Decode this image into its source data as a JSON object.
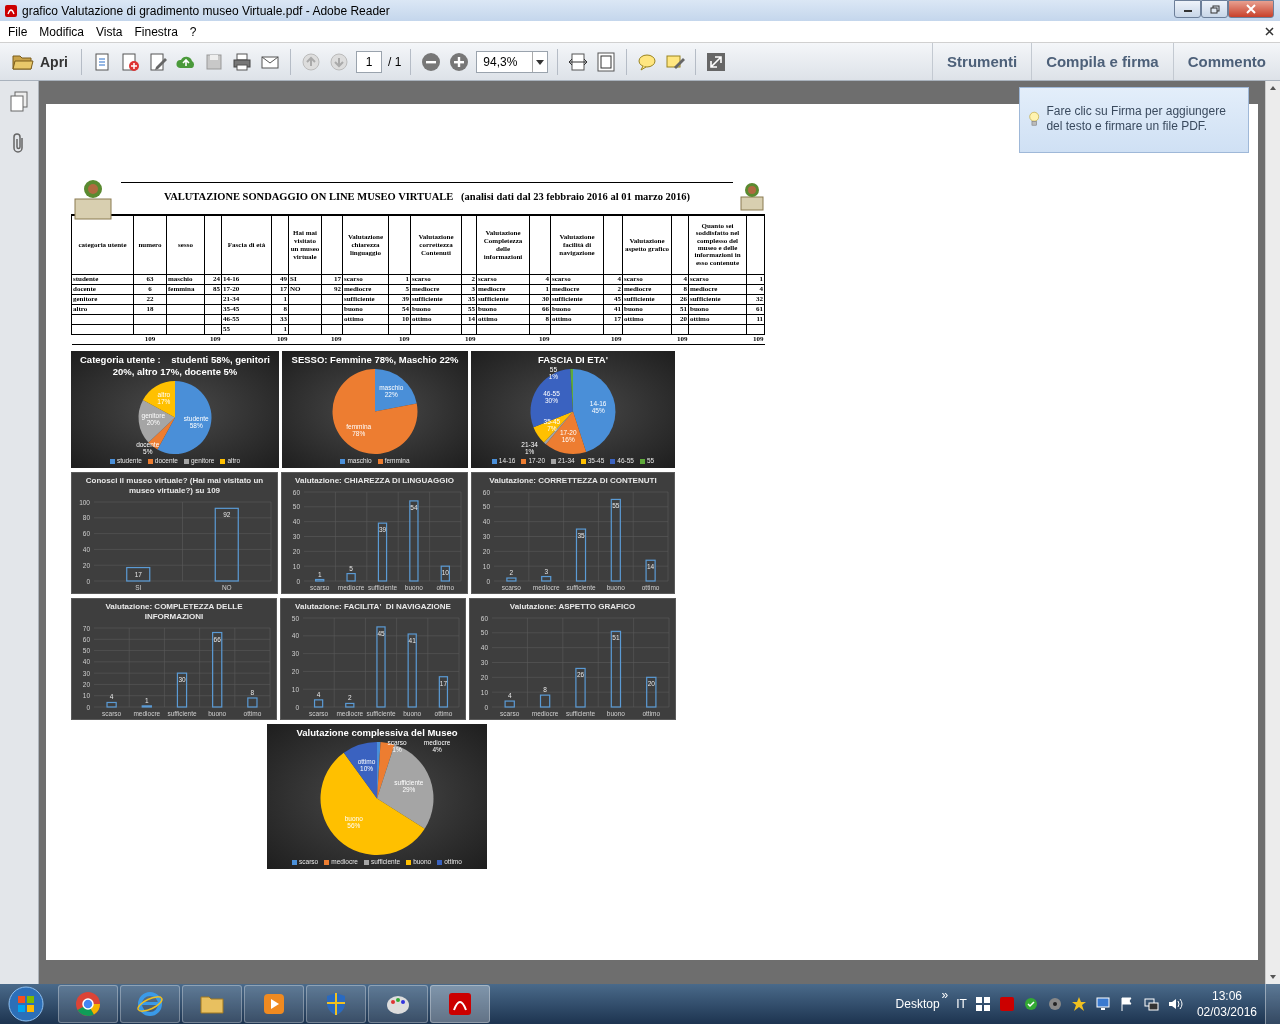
{
  "window": {
    "title": "grafico Valutazione di gradimento museo Virtuale.pdf - Adobe Reader"
  },
  "menu": [
    "File",
    "Modifica",
    "Vista",
    "Finestra",
    "?"
  ],
  "toolbar": {
    "open_label": "Apri",
    "page": "1",
    "page_total": "/ 1",
    "zoom": "94,3%",
    "panels": [
      "Strumenti",
      "Compila e firma",
      "Commento"
    ]
  },
  "tooltip": {
    "text": "Fare clic su Firma per aggiungere del testo e firmare un file PDF."
  },
  "document": {
    "title": "VALUTAZIONE SONDAGGIO ON LINE MUSEO VIRTUALE   (analisi dati dal 23 febbraio 2016 al 01 marzo 2016)",
    "table": {
      "groups": [
        {
          "header": "categoria utente",
          "value_header": "numero",
          "entries": [
            {
              "label": "studente",
              "value": "63"
            },
            {
              "label": "docente",
              "value": "6"
            },
            {
              "label": "genitore",
              "value": "22"
            },
            {
              "label": "altro",
              "value": "18"
            }
          ],
          "total": "109"
        },
        {
          "header": "sesso",
          "entries": [
            {
              "label": "maschio",
              "value": "24"
            },
            {
              "label": "femmina",
              "value": "85"
            }
          ],
          "total": "109"
        },
        {
          "header": "Fascia di età",
          "entries": [
            {
              "label": "14-16",
              "value": "49"
            },
            {
              "label": "17-20",
              "value": "17"
            },
            {
              "label": "21-34",
              "value": "1"
            },
            {
              "label": "35-45",
              "value": "8"
            },
            {
              "label": "46-55",
              "value": "33"
            },
            {
              "label": "55",
              "value": "1"
            }
          ],
          "total": "109"
        },
        {
          "header": "Hai mai visitato un museo virtuale",
          "entries": [
            {
              "label": "SI",
              "value": "17"
            },
            {
              "label": "NO",
              "value": "92"
            }
          ],
          "total": "109"
        },
        {
          "header": "Valutazione chiarezza linguaggio",
          "entries": [
            {
              "label": "scarso",
              "value": "1"
            },
            {
              "label": "mediocre",
              "value": "5"
            },
            {
              "label": "sufficiente",
              "value": "39"
            },
            {
              "label": "buono",
              "value": "54"
            },
            {
              "label": "ottimo",
              "value": "10"
            }
          ],
          "total": "109"
        },
        {
          "header": "Valutazione correttezza Contenuti",
          "entries": [
            {
              "label": "scarso",
              "value": "2"
            },
            {
              "label": "mediocre",
              "value": "3"
            },
            {
              "label": "sufficiente",
              "value": "35"
            },
            {
              "label": "buono",
              "value": "55"
            },
            {
              "label": "ottimo",
              "value": "14"
            }
          ],
          "total": "109"
        },
        {
          "header": "Valutazione Completezza delle informazioni",
          "entries": [
            {
              "label": "scarso",
              "value": "4"
            },
            {
              "label": "mediocre",
              "value": "1"
            },
            {
              "label": "sufficiente",
              "value": "30"
            },
            {
              "label": "buono",
              "value": "66"
            },
            {
              "label": "ottimo",
              "value": "8"
            }
          ],
          "total": "109"
        },
        {
          "header": "Valutazione facilità di navigazione",
          "entries": [
            {
              "label": "scarso",
              "value": "4"
            },
            {
              "label": "mediocre",
              "value": "2"
            },
            {
              "label": "sufficiente",
              "value": "45"
            },
            {
              "label": "buono",
              "value": "41"
            },
            {
              "label": "ottimo",
              "value": "17"
            }
          ],
          "total": "109"
        },
        {
          "header": "Valutazione aspetto grafico",
          "entries": [
            {
              "label": "scarso",
              "value": "4"
            },
            {
              "label": "mediocre",
              "value": "8"
            },
            {
              "label": "sufficiente",
              "value": "26"
            },
            {
              "label": "buono",
              "value": "51"
            },
            {
              "label": "ottimo",
              "value": "20"
            }
          ],
          "total": "109"
        },
        {
          "header": "Quanto sei soddisfatto nel complesso del museo e delle informazioni in esso contenute",
          "entries": [
            {
              "label": "scarso",
              "value": "1"
            },
            {
              "label": "mediocre",
              "value": "4"
            },
            {
              "label": "sufficiente",
              "value": "32"
            },
            {
              "label": "buono",
              "value": "61"
            },
            {
              "label": "ottimo",
              "value": "11"
            }
          ],
          "total": "109"
        }
      ]
    },
    "charts": [
      {
        "chart_data": {
          "type": "pie",
          "title": "Categoria utente :    studenti 58%, genitori 20%, altro 17%, docente 5%",
          "categories": [
            "studente",
            "docente",
            "genitore",
            "altro"
          ],
          "legend": "bottom",
          "value_labels": [
            "58%",
            "5%",
            "20%",
            "17%"
          ],
          "series": [
            {
              "values": [
                58,
                5,
                20,
                17
              ],
              "colors": [
                "#4a8fd8",
                "#ed7d31",
                "#a5a5a5",
                "#ffc000"
              ]
            }
          ]
        }
      },
      {
        "chart_data": {
          "type": "pie",
          "title": "SESSO: Femmine 78%, Maschio 22%",
          "categories": [
            "maschio",
            "femmina"
          ],
          "legend": "bottom",
          "value_labels": [
            "22%",
            "78%"
          ],
          "series": [
            {
              "values": [
                22,
                78
              ],
              "colors": [
                "#4a8fd8",
                "#ed7d31"
              ]
            }
          ]
        }
      },
      {
        "chart_data": {
          "type": "pie",
          "title": "FASCIA DI ETA'",
          "categories": [
            "14-16",
            "17-20",
            "21-34",
            "35-45",
            "46-55",
            "55"
          ],
          "legend": "bottom",
          "value_labels": [
            "45%",
            "16%",
            "1%",
            "7%",
            "30%",
            "1%"
          ],
          "series": [
            {
              "values": [
                45,
                16,
                1,
                7,
                30,
                1
              ],
              "colors": [
                "#4a8fd8",
                "#ed7d31",
                "#a5a5a5",
                "#ffc000",
                "#3a62c0",
                "#5faa3a"
              ]
            }
          ]
        }
      },
      {
        "chart_data": {
          "type": "bar",
          "title": "Conosci il museo virtuale? (Hai mai visitato un museo virtuale?) su 109",
          "categories": [
            "SI",
            "NO"
          ],
          "ylim": [
            0,
            100
          ],
          "yticks": [
            0,
            20,
            40,
            60,
            80,
            100
          ],
          "grid": true,
          "data_labels": true,
          "series": [
            {
              "color": "#5b9bd5",
              "values": [
                17,
                92
              ]
            }
          ]
        }
      },
      {
        "chart_data": {
          "type": "bar",
          "title": "Valutazione: CHIAREZZA DI LINGUAGGIO",
          "categories": [
            "scarso",
            "mediocre",
            "sufficiente",
            "buono",
            "ottimo"
          ],
          "ylim": [
            0,
            60
          ],
          "yticks": [
            0,
            10,
            20,
            30,
            40,
            50,
            60
          ],
          "grid": true,
          "data_labels": true,
          "series": [
            {
              "color": "#5b9bd5",
              "values": [
                1,
                5,
                39,
                54,
                10
              ]
            }
          ]
        }
      },
      {
        "chart_data": {
          "type": "bar",
          "title": "Valutazione: CORRETTEZZA DI CONTENUTI",
          "categories": [
            "scarso",
            "mediocre",
            "sufficiente",
            "buono",
            "ottimo"
          ],
          "ylim": [
            0,
            60
          ],
          "yticks": [
            0,
            10,
            20,
            30,
            40,
            50,
            60
          ],
          "grid": true,
          "data_labels": true,
          "series": [
            {
              "color": "#5b9bd5",
              "values": [
                2,
                3,
                35,
                55,
                14
              ]
            }
          ]
        }
      },
      {
        "chart_data": {
          "type": "bar",
          "title": "Valutazione: COMPLETEZZA DELLE INFORMAZIONI",
          "categories": [
            "scarso",
            "mediocre",
            "sufficiente",
            "buono",
            "ottimo"
          ],
          "ylim": [
            0,
            70
          ],
          "yticks": [
            0,
            10,
            20,
            30,
            40,
            50,
            60,
            70
          ],
          "grid": true,
          "data_labels": true,
          "series": [
            {
              "color": "#5b9bd5",
              "values": [
                4,
                1,
                30,
                66,
                8
              ]
            }
          ]
        }
      },
      {
        "chart_data": {
          "type": "bar",
          "title": "Valutazione: FACILITA'  DI NAVIGAZIONE",
          "categories": [
            "scarso",
            "mediocre",
            "sufficiente",
            "buono",
            "ottimo"
          ],
          "ylim": [
            0,
            50
          ],
          "yticks": [
            0,
            10,
            20,
            30,
            40,
            50
          ],
          "grid": true,
          "data_labels": true,
          "series": [
            {
              "color": "#5b9bd5",
              "values": [
                4,
                2,
                45,
                41,
                17
              ]
            }
          ]
        }
      },
      {
        "chart_data": {
          "type": "bar",
          "title": "Valutazione: ASPETTO GRAFICO",
          "categories": [
            "scarso",
            "mediocre",
            "sufficiente",
            "buono",
            "ottimo"
          ],
          "ylim": [
            0,
            60
          ],
          "yticks": [
            0,
            10,
            20,
            30,
            40,
            50,
            60
          ],
          "grid": true,
          "data_labels": true,
          "series": [
            {
              "color": "#5b9bd5",
              "values": [
                4,
                8,
                26,
                51,
                20
              ]
            }
          ]
        }
      },
      {
        "chart_data": {
          "type": "pie",
          "title": "Valutazione complessiva del Museo",
          "categories": [
            "scarso",
            "mediocre",
            "sufficiente",
            "buono",
            "ottimo"
          ],
          "legend": "bottom",
          "value_labels": [
            "1%",
            "4%",
            "29%",
            "56%",
            "10%"
          ],
          "series": [
            {
              "values": [
                1,
                4,
                29,
                56,
                10
              ],
              "colors": [
                "#4a8fd8",
                "#ed7d31",
                "#a5a5a5",
                "#ffc000",
                "#3a62c0"
              ]
            }
          ]
        }
      }
    ]
  },
  "taskbar": {
    "desktop_label": "Desktop",
    "chevron": "»",
    "language": "IT",
    "time": "13:06",
    "date": "02/03/2016"
  }
}
